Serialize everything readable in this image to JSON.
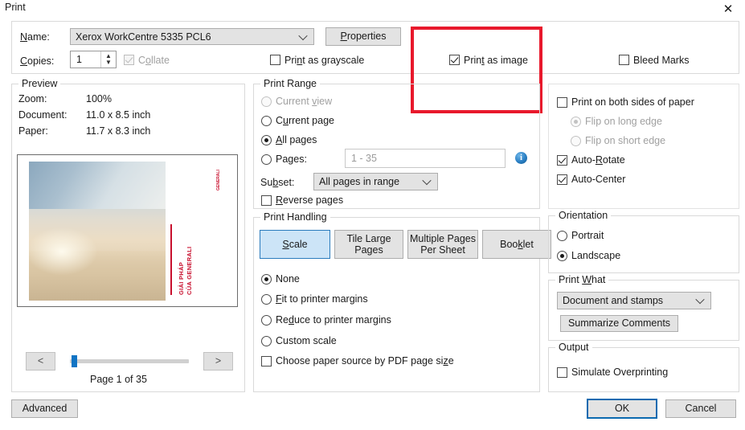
{
  "window": {
    "title": "Print",
    "close_label": "✕"
  },
  "printer": {
    "name_label": "Name:",
    "name_value": "Xerox WorkCentre 5335 PCL6",
    "properties_button": "Properties",
    "copies_label": "Copies:",
    "copies_value": "1",
    "collate_label": "Collate",
    "collate_checked": true,
    "collate_disabled": true,
    "grayscale_label": "Print as grayscale",
    "grayscale_checked": false,
    "print_as_image_label": "Print as image",
    "print_as_image_checked": true,
    "bleed_marks_label": "Bleed Marks",
    "bleed_marks_checked": false
  },
  "highlight": {
    "color": "#e8192c",
    "target": "print-as-image-checkbox"
  },
  "preview": {
    "group_title": "Preview",
    "zoom_label": "Zoom:",
    "zoom_value": "100%",
    "document_label": "Document:",
    "document_value": "11.0 x 8.5 inch",
    "paper_label": "Paper:",
    "paper_value": "11.7 x 8.3 inch",
    "thumbnail_headline_line1": "GIẢI PHÁP",
    "thumbnail_headline_line2": "CỦA GENERALI",
    "thumbnail_logo": "GENERALI",
    "thumbnail_accent_color": "#c8102e",
    "prev_button": "<",
    "next_button": ">",
    "page_status": "Page 1 of 35",
    "slider_position_percent": 3
  },
  "print_range": {
    "group_title": "Print Range",
    "options": [
      {
        "label": "Current view",
        "selected": false,
        "disabled": true
      },
      {
        "label": "Current page",
        "selected": false,
        "disabled": false
      },
      {
        "label": "All pages",
        "selected": true,
        "disabled": false
      },
      {
        "label": "Pages:",
        "selected": false,
        "disabled": false
      }
    ],
    "pages_placeholder": "1 - 35",
    "pages_value": "",
    "info_icon": "i",
    "subset_label": "Subset:",
    "subset_value": "All pages in range",
    "reverse_pages_label": "Reverse pages",
    "reverse_pages_checked": false
  },
  "print_handling": {
    "group_title": "Print Handling",
    "tabs": [
      {
        "label": "Scale",
        "selected": true
      },
      {
        "label": "Tile Large\nPages",
        "line1": "Tile Large",
        "line2": "Pages",
        "selected": false
      },
      {
        "label": "Multiple Pages\nPer Sheet",
        "line1": "Multiple Pages",
        "line2": "Per Sheet",
        "selected": false
      },
      {
        "label": "Booklet",
        "selected": false
      }
    ],
    "scale_options": [
      {
        "label": "None",
        "selected": true
      },
      {
        "label": "Fit to printer margins",
        "selected": false
      },
      {
        "label": "Reduce to printer margins",
        "selected": false
      },
      {
        "label": "Custom scale",
        "selected": false
      }
    ],
    "paper_source_label": "Choose paper source by PDF page size",
    "paper_source_checked": false
  },
  "duplex": {
    "both_sides_label": "Print on both sides of paper",
    "both_sides_checked": false,
    "flip_long_label": "Flip on long edge",
    "flip_long_selected": true,
    "flip_long_disabled": true,
    "flip_short_label": "Flip on short edge",
    "flip_short_selected": false,
    "flip_short_disabled": true,
    "auto_rotate_label": "Auto-Rotate",
    "auto_rotate_checked": true,
    "auto_center_label": "Auto-Center",
    "auto_center_checked": true
  },
  "orientation": {
    "group_title": "Orientation",
    "options": [
      {
        "label": "Portrait",
        "selected": false
      },
      {
        "label": "Landscape",
        "selected": true
      }
    ]
  },
  "print_what": {
    "group_title": "Print What",
    "value": "Document and stamps",
    "summarize_button": "Summarize Comments"
  },
  "output": {
    "group_title": "Output",
    "simulate_overprinting_label": "Simulate Overprinting",
    "simulate_overprinting_checked": false
  },
  "footer": {
    "advanced_button": "Advanced",
    "ok_button": "OK",
    "cancel_button": "Cancel"
  }
}
